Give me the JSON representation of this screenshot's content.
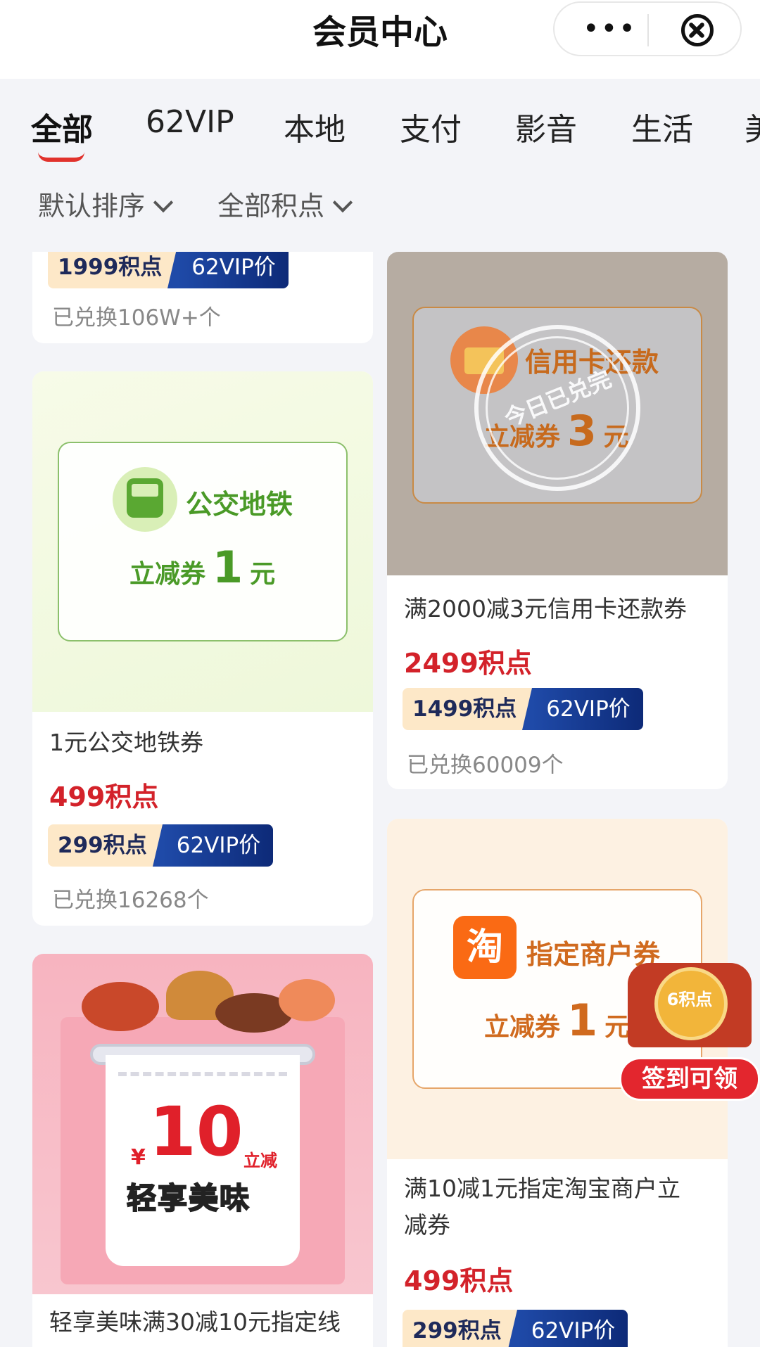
{
  "header": {
    "title": "会员中心",
    "more_label": "•••"
  },
  "tabs": [
    {
      "label": "全部"
    },
    {
      "label": "62VIP"
    },
    {
      "label": "本地"
    },
    {
      "label": "支付"
    },
    {
      "label": "影音"
    },
    {
      "label": "生活"
    },
    {
      "label": "美"
    }
  ],
  "filters": {
    "sort": "默认排序",
    "points": "全部积点"
  },
  "cards": {
    "top_left": {
      "vip_points": "1999积点",
      "vip_label": "62VIP价",
      "exchanged": "已兑换106W+个"
    },
    "credit": {
      "coupon_title": "信用卡还款",
      "coupon_sub_prefix": "立减券",
      "coupon_amount": "3",
      "coupon_unit": "元",
      "stamp_text": "今日已兑完",
      "name": "满2000减3元信用卡还款券",
      "price": "2499积点",
      "vip_points": "1499积点",
      "vip_label": "62VIP价",
      "exchanged": "已兑换60009个"
    },
    "bus": {
      "coupon_title": "公交地铁",
      "coupon_sub_prefix": "立减券",
      "coupon_amount": "1",
      "coupon_unit": "元",
      "name": "1元公交地铁券",
      "price": "499积点",
      "vip_points": "299积点",
      "vip_label": "62VIP价",
      "exchanged": "已兑换16268个"
    },
    "taobao": {
      "icon_char": "淘",
      "coupon_title": "指定商户券",
      "coupon_sub_prefix": "立减券",
      "coupon_amount": "1",
      "coupon_unit": "元",
      "name_line1": "满10减1元指定淘宝商户立",
      "name_line2": "减券",
      "price": "499积点",
      "vip_points": "299积点",
      "vip_label": "62VIP价"
    },
    "food": {
      "currency": "¥",
      "amount": "10",
      "tag": "立减",
      "slogan": "轻享美味",
      "name": "轻享美味满30减10元指定线"
    }
  },
  "float_badge": {
    "points": "6积点",
    "label": "签到可领"
  }
}
